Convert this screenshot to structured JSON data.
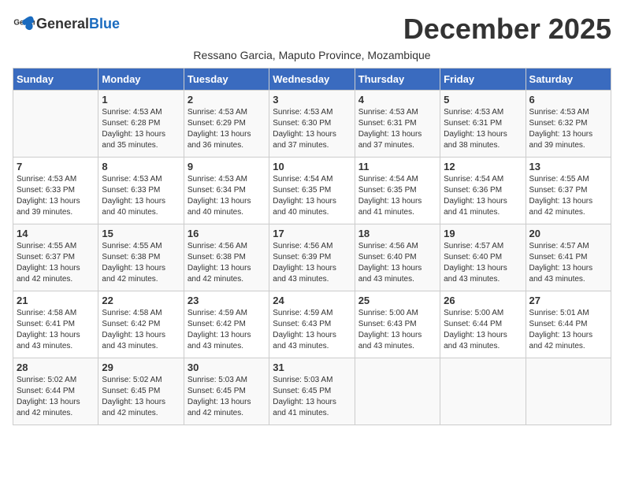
{
  "header": {
    "logo_general": "General",
    "logo_blue": "Blue",
    "month_title": "December 2025",
    "subtitle": "Ressano Garcia, Maputo Province, Mozambique"
  },
  "calendar": {
    "day_headers": [
      "Sunday",
      "Monday",
      "Tuesday",
      "Wednesday",
      "Thursday",
      "Friday",
      "Saturday"
    ],
    "weeks": [
      [
        {
          "day": "",
          "info": ""
        },
        {
          "day": "1",
          "info": "Sunrise: 4:53 AM\nSunset: 6:28 PM\nDaylight: 13 hours\nand 35 minutes."
        },
        {
          "day": "2",
          "info": "Sunrise: 4:53 AM\nSunset: 6:29 PM\nDaylight: 13 hours\nand 36 minutes."
        },
        {
          "day": "3",
          "info": "Sunrise: 4:53 AM\nSunset: 6:30 PM\nDaylight: 13 hours\nand 37 minutes."
        },
        {
          "day": "4",
          "info": "Sunrise: 4:53 AM\nSunset: 6:31 PM\nDaylight: 13 hours\nand 37 minutes."
        },
        {
          "day": "5",
          "info": "Sunrise: 4:53 AM\nSunset: 6:31 PM\nDaylight: 13 hours\nand 38 minutes."
        },
        {
          "day": "6",
          "info": "Sunrise: 4:53 AM\nSunset: 6:32 PM\nDaylight: 13 hours\nand 39 minutes."
        }
      ],
      [
        {
          "day": "7",
          "info": "Sunrise: 4:53 AM\nSunset: 6:33 PM\nDaylight: 13 hours\nand 39 minutes."
        },
        {
          "day": "8",
          "info": "Sunrise: 4:53 AM\nSunset: 6:33 PM\nDaylight: 13 hours\nand 40 minutes."
        },
        {
          "day": "9",
          "info": "Sunrise: 4:53 AM\nSunset: 6:34 PM\nDaylight: 13 hours\nand 40 minutes."
        },
        {
          "day": "10",
          "info": "Sunrise: 4:54 AM\nSunset: 6:35 PM\nDaylight: 13 hours\nand 40 minutes."
        },
        {
          "day": "11",
          "info": "Sunrise: 4:54 AM\nSunset: 6:35 PM\nDaylight: 13 hours\nand 41 minutes."
        },
        {
          "day": "12",
          "info": "Sunrise: 4:54 AM\nSunset: 6:36 PM\nDaylight: 13 hours\nand 41 minutes."
        },
        {
          "day": "13",
          "info": "Sunrise: 4:55 AM\nSunset: 6:37 PM\nDaylight: 13 hours\nand 42 minutes."
        }
      ],
      [
        {
          "day": "14",
          "info": "Sunrise: 4:55 AM\nSunset: 6:37 PM\nDaylight: 13 hours\nand 42 minutes."
        },
        {
          "day": "15",
          "info": "Sunrise: 4:55 AM\nSunset: 6:38 PM\nDaylight: 13 hours\nand 42 minutes."
        },
        {
          "day": "16",
          "info": "Sunrise: 4:56 AM\nSunset: 6:38 PM\nDaylight: 13 hours\nand 42 minutes."
        },
        {
          "day": "17",
          "info": "Sunrise: 4:56 AM\nSunset: 6:39 PM\nDaylight: 13 hours\nand 43 minutes."
        },
        {
          "day": "18",
          "info": "Sunrise: 4:56 AM\nSunset: 6:40 PM\nDaylight: 13 hours\nand 43 minutes."
        },
        {
          "day": "19",
          "info": "Sunrise: 4:57 AM\nSunset: 6:40 PM\nDaylight: 13 hours\nand 43 minutes."
        },
        {
          "day": "20",
          "info": "Sunrise: 4:57 AM\nSunset: 6:41 PM\nDaylight: 13 hours\nand 43 minutes."
        }
      ],
      [
        {
          "day": "21",
          "info": "Sunrise: 4:58 AM\nSunset: 6:41 PM\nDaylight: 13 hours\nand 43 minutes."
        },
        {
          "day": "22",
          "info": "Sunrise: 4:58 AM\nSunset: 6:42 PM\nDaylight: 13 hours\nand 43 minutes."
        },
        {
          "day": "23",
          "info": "Sunrise: 4:59 AM\nSunset: 6:42 PM\nDaylight: 13 hours\nand 43 minutes."
        },
        {
          "day": "24",
          "info": "Sunrise: 4:59 AM\nSunset: 6:43 PM\nDaylight: 13 hours\nand 43 minutes."
        },
        {
          "day": "25",
          "info": "Sunrise: 5:00 AM\nSunset: 6:43 PM\nDaylight: 13 hours\nand 43 minutes."
        },
        {
          "day": "26",
          "info": "Sunrise: 5:00 AM\nSunset: 6:44 PM\nDaylight: 13 hours\nand 43 minutes."
        },
        {
          "day": "27",
          "info": "Sunrise: 5:01 AM\nSunset: 6:44 PM\nDaylight: 13 hours\nand 42 minutes."
        }
      ],
      [
        {
          "day": "28",
          "info": "Sunrise: 5:02 AM\nSunset: 6:44 PM\nDaylight: 13 hours\nand 42 minutes."
        },
        {
          "day": "29",
          "info": "Sunrise: 5:02 AM\nSunset: 6:45 PM\nDaylight: 13 hours\nand 42 minutes."
        },
        {
          "day": "30",
          "info": "Sunrise: 5:03 AM\nSunset: 6:45 PM\nDaylight: 13 hours\nand 42 minutes."
        },
        {
          "day": "31",
          "info": "Sunrise: 5:03 AM\nSunset: 6:45 PM\nDaylight: 13 hours\nand 41 minutes."
        },
        {
          "day": "",
          "info": ""
        },
        {
          "day": "",
          "info": ""
        },
        {
          "day": "",
          "info": ""
        }
      ]
    ]
  }
}
